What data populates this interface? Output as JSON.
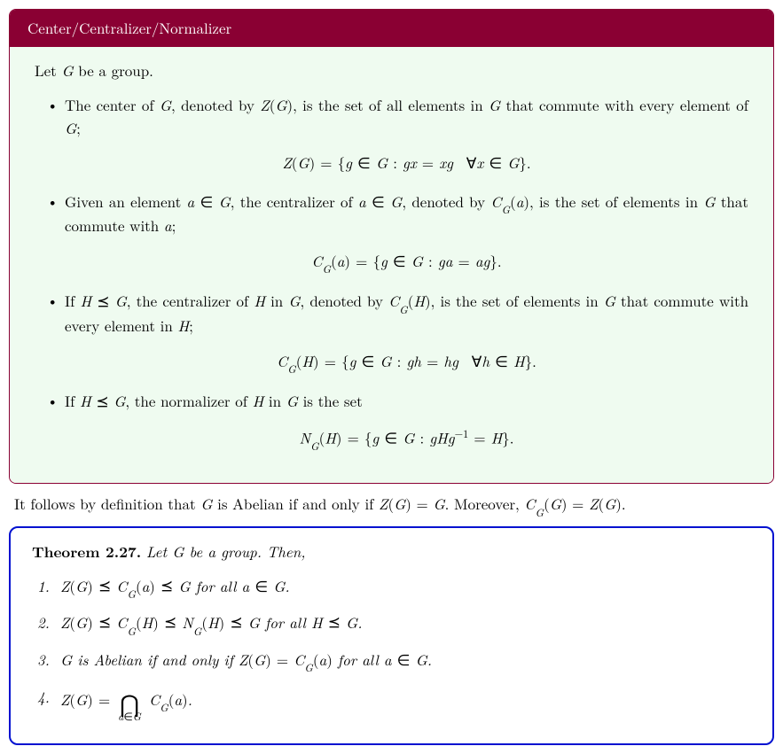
{
  "defbox": {
    "title": "Center/Centralizer/Normalizer",
    "intro": "Let G be a group.",
    "items": [
      {
        "text": "The center of G, denoted by Z(G), is the set of all elements in G that commute with every element of G;",
        "math": "Z(G) = {g ∈ G : gx = xg ∀x ∈ G}."
      },
      {
        "text": "Given an element a ∈ G, the centralizer of a ∈ G, denoted by C_G(a), is the set of elements in G that commute with a;",
        "math": "C_G(a) = {g ∈ G : ga = ag}."
      },
      {
        "text": "If H ⪯ G, the centralizer of H in G, denoted by C_G(H), is the set of elements in G that commute with every element in H;",
        "math": "C_G(H) = {g ∈ G : gh = hg ∀h ∈ H}."
      },
      {
        "text": "If H ⪯ G, the normalizer of H in G is the set",
        "math": "N_G(H) = {g ∈ G : gHg⁻¹ = H}."
      }
    ]
  },
  "middle": "It follows by definition that G is Abelian if and only if Z(G) = G. Moreover, C_G(G) = Z(G).",
  "theorem": {
    "label": "Theorem 2.27.",
    "intro": "Let G be a group. Then,",
    "items": [
      "Z(G) ⪯ C_G(a) ⪯ G for all a ∈ G.",
      "Z(G) ⪯ C_G(H) ⪯ N_G(H) ⪯ G for all H ⪯ G.",
      "G is Abelian if and only if Z(G) = C_G(a) for all a ∈ G.",
      "Z(G) = ⋂_{a∈G} C_G(a)."
    ]
  }
}
